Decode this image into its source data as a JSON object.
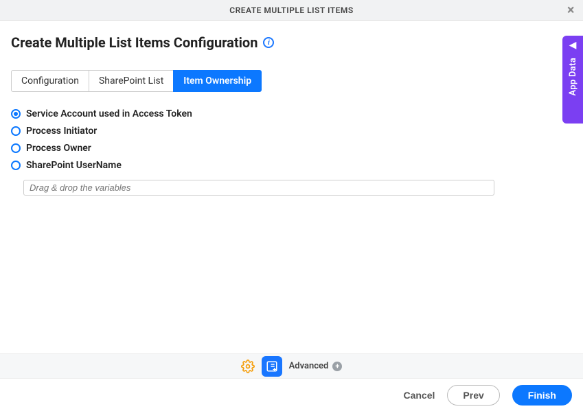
{
  "topbar": {
    "title": "CREATE MULTIPLE LIST ITEMS"
  },
  "page": {
    "heading": "Create Multiple List Items Configuration"
  },
  "tabs": [
    {
      "label": "Configuration",
      "active": false
    },
    {
      "label": "SharePoint List",
      "active": false
    },
    {
      "label": "Item Ownership",
      "active": true
    }
  ],
  "radios": [
    {
      "label": "Service Account used in Access Token",
      "checked": true
    },
    {
      "label": "Process Initiator",
      "checked": false
    },
    {
      "label": "Process Owner",
      "checked": false
    },
    {
      "label": "SharePoint UserName",
      "checked": false
    }
  ],
  "dropzone": {
    "placeholder": "Drag & drop the variables"
  },
  "sideTab": {
    "label": "App Data"
  },
  "footer": {
    "advanced": "Advanced",
    "cancel": "Cancel",
    "prev": "Prev",
    "finish": "Finish"
  }
}
